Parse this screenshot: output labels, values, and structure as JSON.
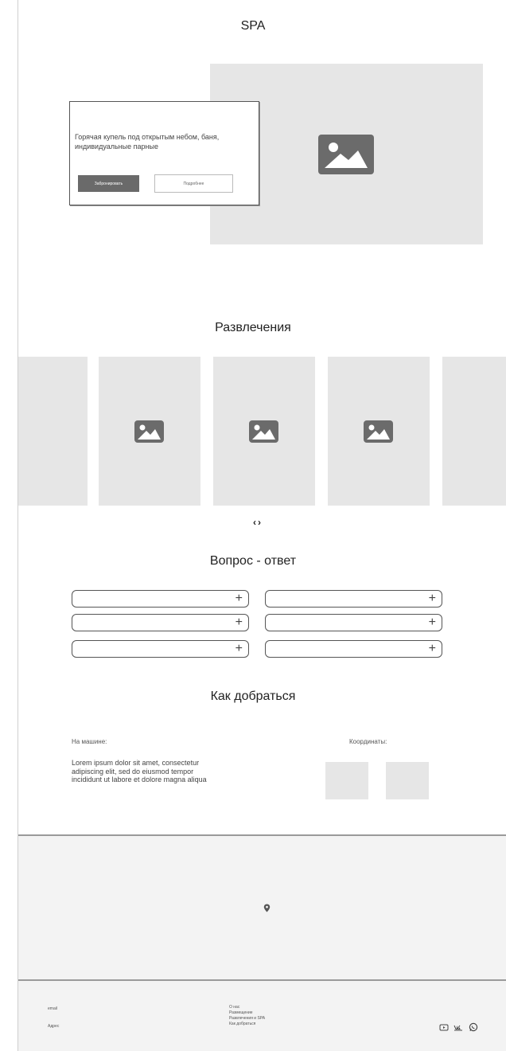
{
  "spa": {
    "title": "SPA",
    "card_text": "Горячая купель под открытым небом, баня, индивидуальные парные",
    "book_button": "Забронировать",
    "more_button": "Подробнее"
  },
  "entertainment": {
    "title": "Развлечения",
    "prev_arrow": "‹",
    "next_arrow": "›"
  },
  "faq": {
    "title": "Вопрос - ответ",
    "toggle_symbol": "+"
  },
  "directions": {
    "title": "Как добраться",
    "by_car_label": "На машине:",
    "by_car_text": "Lorem ipsum dolor sit amet, consectetur adipiscing elit, sed do eiusmod tempor incididunt ut labore et dolore magna aliqua",
    "coords_label": "Координаты:"
  },
  "footer": {
    "email": "email",
    "address": "Адрес",
    "links": [
      "О нас",
      "Размещение",
      "Развлечения и SPA",
      "Как добраться"
    ],
    "social_icons": [
      "youtube-icon",
      "vk-icon",
      "whatsapp-icon"
    ]
  },
  "colors": {
    "placeholder": "#e6e6e6",
    "icon": "#6b6b6b",
    "map_bg": "#f3f3f3"
  }
}
